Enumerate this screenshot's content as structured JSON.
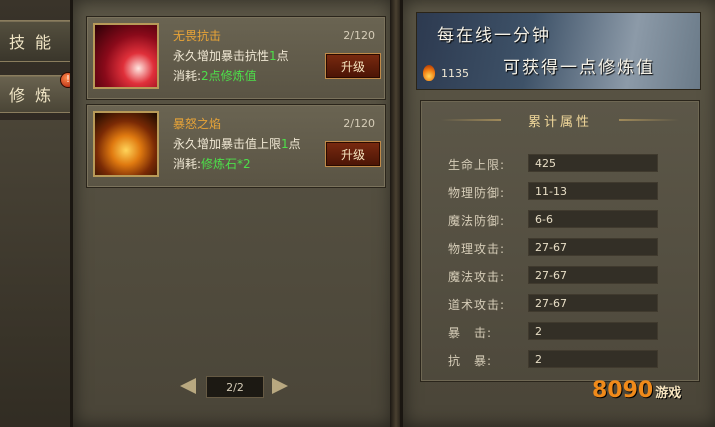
{
  "tabs": [
    {
      "label": "技能"
    },
    {
      "label": "修炼",
      "badge": "!"
    }
  ],
  "skills": [
    {
      "name": "无畏抗击",
      "level": "2/120",
      "desc_prefix": "永久增加暴击抗性",
      "desc_num": "1",
      "desc_suffix": "点",
      "cost_prefix": "消耗:",
      "cost_value": "2点修炼值",
      "button": "升级",
      "icon": "red-strike-icon"
    },
    {
      "name": "暴怒之焰",
      "level": "2/120",
      "desc_prefix": "永久增加暴击值上限",
      "desc_num": "1",
      "desc_suffix": "点",
      "cost_prefix": "消耗:",
      "cost_value": "修炼石*2",
      "button": "升级",
      "icon": "fire-warrior-icon"
    }
  ],
  "pager": {
    "label": "2/2"
  },
  "banner": {
    "line1": "每在线一分钟",
    "line2": "可获得一点修炼值",
    "value": "1135"
  },
  "attributes": {
    "title": "累计属性",
    "rows": [
      {
        "label": "生命上限:",
        "value": "425"
      },
      {
        "label": "物理防御:",
        "value": "11-13"
      },
      {
        "label": "魔法防御:",
        "value": "6-6"
      },
      {
        "label": "物理攻击:",
        "value": "27-67"
      },
      {
        "label": "魔法攻击:",
        "value": "27-67"
      },
      {
        "label": "道术攻击:",
        "value": "27-67"
      },
      {
        "label": "暴　击:",
        "value": "2"
      },
      {
        "label": "抗　暴:",
        "value": "2"
      }
    ]
  },
  "logo": {
    "text": "8090",
    "sub": "游戏"
  },
  "colors": {
    "accent": "#e9a437",
    "highlight": "#4de04a",
    "button": "#7a2a10"
  }
}
